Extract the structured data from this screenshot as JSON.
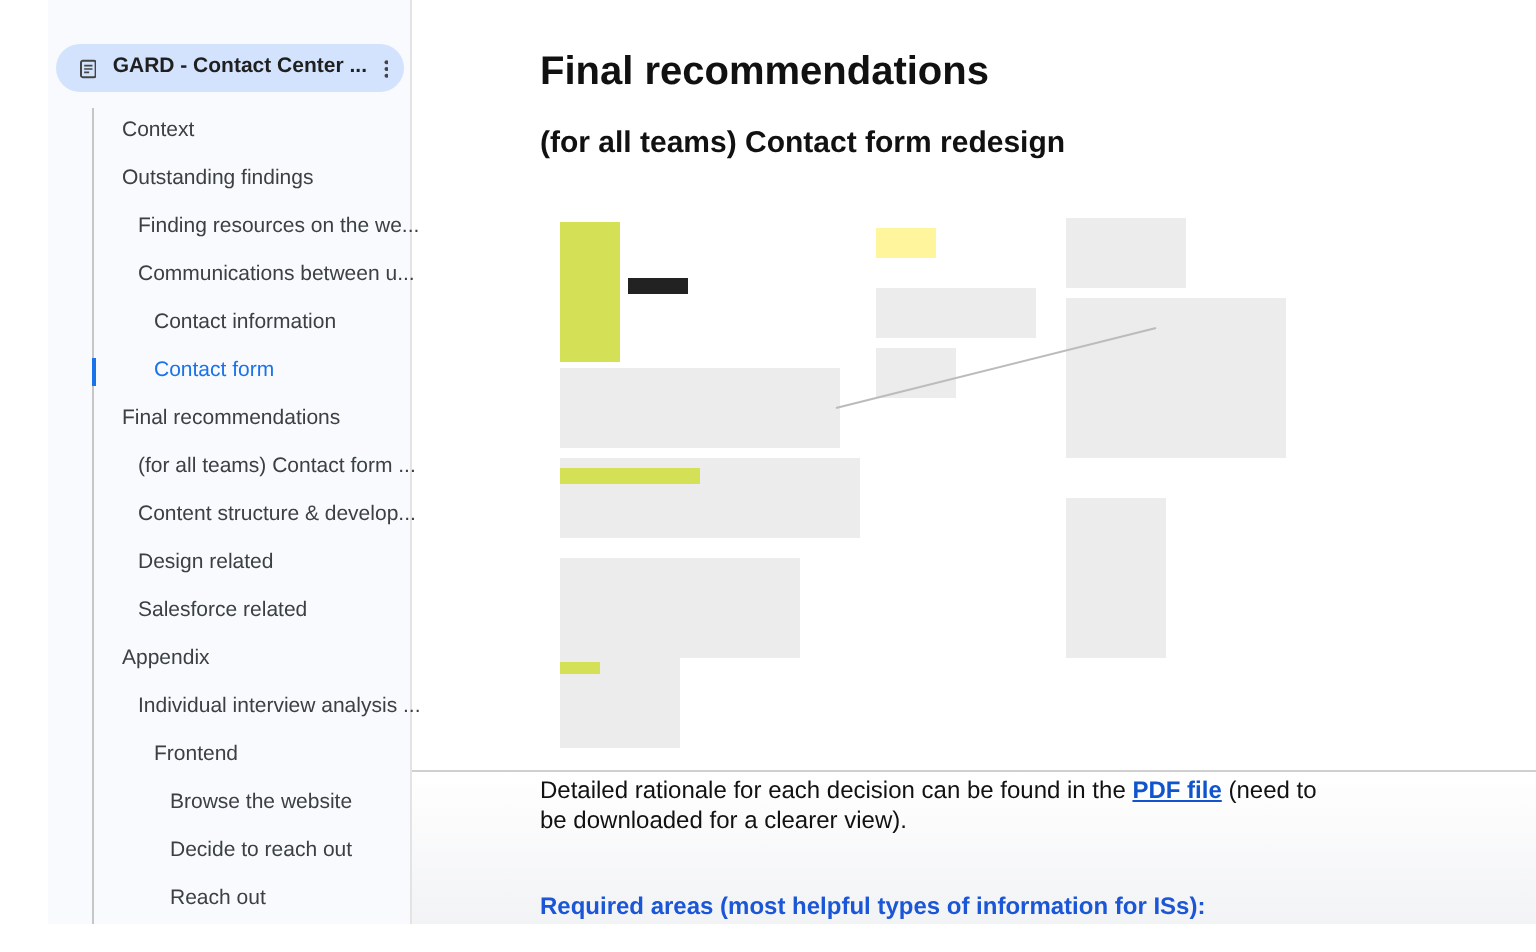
{
  "outline": {
    "title": "GARD - Contact Center ...",
    "items": [
      {
        "label": "Context",
        "selected": false
      },
      {
        "label": "Outstanding findings",
        "selected": false,
        "children": [
          {
            "label": "Finding resources on the we...",
            "selected": false
          },
          {
            "label": "Communications between u...",
            "selected": false,
            "children": [
              {
                "label": "Contact information",
                "selected": false
              },
              {
                "label": "Contact form",
                "selected": true
              }
            ]
          }
        ]
      },
      {
        "label": "Final recommendations",
        "selected": false,
        "children": [
          {
            "label": "(for all teams) Contact form ...",
            "selected": false
          },
          {
            "label": "Content structure & develop...",
            "selected": false
          },
          {
            "label": "Design related",
            "selected": false
          },
          {
            "label": "Salesforce related",
            "selected": false
          }
        ]
      },
      {
        "label": "Appendix",
        "selected": false,
        "children": [
          {
            "label": "Individual interview analysis ...",
            "selected": false,
            "children": [
              {
                "label": "Frontend",
                "selected": false,
                "children": [
                  {
                    "label": "Browse the website",
                    "selected": false
                  },
                  {
                    "label": "Decide to reach out",
                    "selected": false
                  },
                  {
                    "label": "Reach out",
                    "selected": false
                  }
                ]
              }
            ]
          }
        ]
      }
    ]
  },
  "document": {
    "heading": "Final recommendations",
    "subheading": "(for all teams) Contact form redesign",
    "paragraph": {
      "before": "Detailed rationale for each decision can be found in the",
      "link": "PDF file",
      "after": "(need to be downloaded for a clearer view)."
    },
    "section_heading": "Required areas (most helpful types of information for ISs):"
  }
}
